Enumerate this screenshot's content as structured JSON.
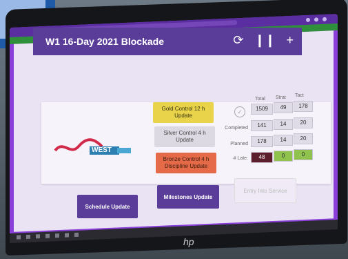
{
  "header": {
    "title": "W1 16-Day 2021 Blockade",
    "icons": [
      "refresh-icon",
      "pause-icon",
      "add-icon"
    ]
  },
  "logo": {
    "text": "WEST"
  },
  "controls": {
    "gold": "Gold Control 12 h Update",
    "silver": "Silver Control 4 h Update",
    "bronze": "Bronze Control 4 h Discipline Update"
  },
  "table": {
    "columns": [
      "Total",
      "Strat",
      "Tact"
    ],
    "rows": [
      {
        "label": "",
        "values": [
          "1509",
          "49",
          "178"
        ]
      },
      {
        "label": "Completed",
        "values": [
          "141",
          "14",
          "20"
        ]
      },
      {
        "label": "Planned",
        "values": [
          "178",
          "14",
          "20"
        ]
      },
      {
        "label": "# Late:",
        "values": [
          "48",
          "0",
          "0"
        ]
      }
    ]
  },
  "buttons": {
    "schedule": "Schedule Update",
    "milestones": "Milestones Update",
    "entry": "Entry Into Service"
  },
  "device": {
    "brand": "hp"
  }
}
